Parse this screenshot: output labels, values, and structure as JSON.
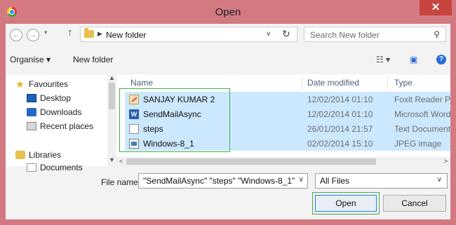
{
  "window": {
    "title": "Open",
    "close_label": "✕"
  },
  "address_bar": {
    "path": "New folder",
    "search_placeholder": "Search New folder"
  },
  "toolbar": {
    "organise_label": "Organise ▾",
    "new_folder_label": "New folder"
  },
  "nav_pane": {
    "favourites_label": "Favourites",
    "items": [
      {
        "label": "Desktop"
      },
      {
        "label": "Downloads"
      },
      {
        "label": "Recent places"
      }
    ],
    "libraries_label": "Libraries",
    "documents_label": "Documents"
  },
  "file_list": {
    "headers": {
      "name": "Name",
      "date": "Date modified",
      "type": "Type"
    },
    "rows": [
      {
        "name": "SANJAY KUMAR 2",
        "date": "12/02/2014 01:10",
        "type": "Foxit Reader PDF",
        "icon": "pdf-icon"
      },
      {
        "name": "SendMailAsync",
        "date": "12/02/2014 01:10",
        "type": "Microsoft Word D",
        "icon": "word-icon"
      },
      {
        "name": "steps",
        "date": "26/01/2014 21:57",
        "type": "Text Document",
        "icon": "text-icon"
      },
      {
        "name": "Windows-8_1",
        "date": "02/02/2014 15:10",
        "type": "JPEG image",
        "icon": "jpeg-icon"
      }
    ]
  },
  "bottom": {
    "file_name_label": "File name:",
    "file_name_value": "\"SendMailAsync\" \"steps\" \"Windows-8_1\"",
    "filter_value": "All Files",
    "open_label": "Open",
    "cancel_label": "Cancel"
  },
  "colors": {
    "frame": "#d27982",
    "selection": "#cce8ff",
    "highlight_box": "#3fae46",
    "close": "#c8453f"
  }
}
